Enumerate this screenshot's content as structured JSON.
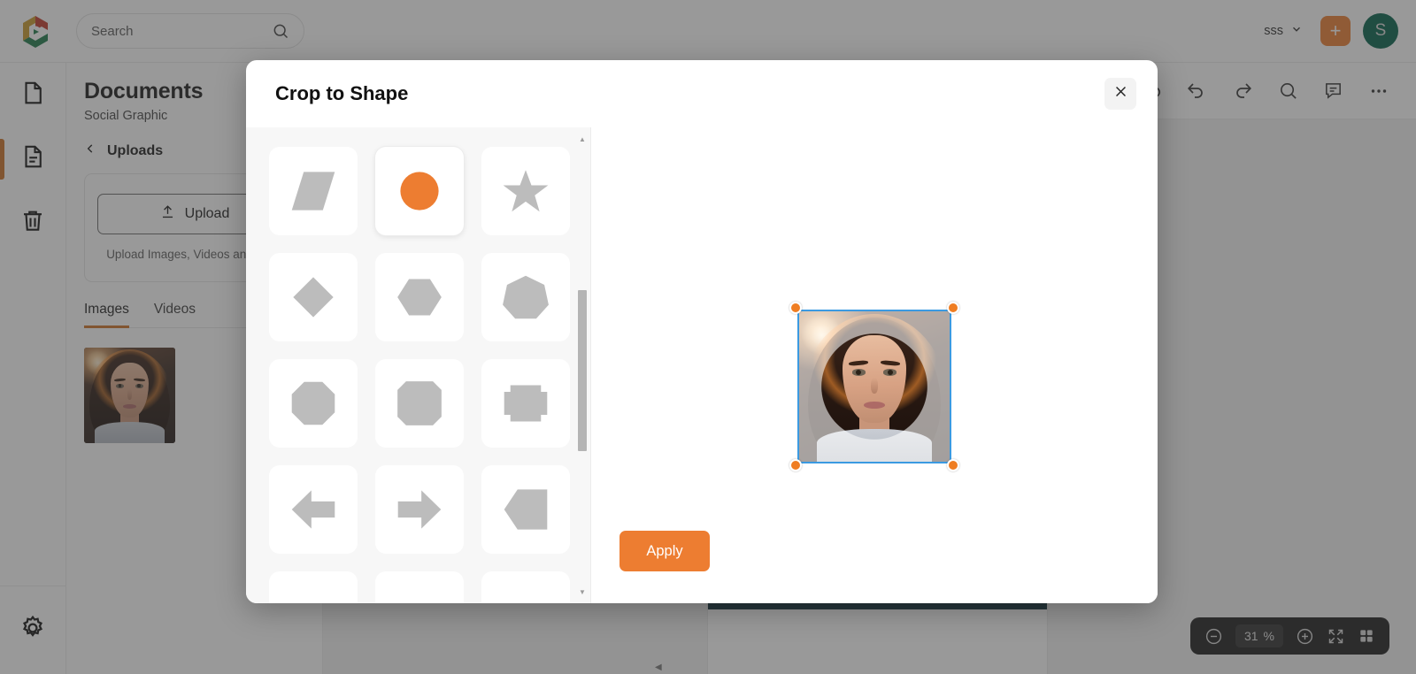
{
  "topbar": {
    "logo_icon": "app-logo-hexagon",
    "search": {
      "value": "",
      "placeholder": "Search",
      "icon": "search-icon"
    },
    "brand": {
      "label": "sss",
      "chevron_icon": "chevron-down-icon"
    },
    "create_button": {
      "label": "+",
      "icon": "plus-icon",
      "color": "#ed7d31"
    },
    "avatar": {
      "initial": "S",
      "color": "#04614a"
    }
  },
  "rail": {
    "items": [
      {
        "icon": "page-blank-icon",
        "active": false
      },
      {
        "icon": "document-lines-icon",
        "active": true
      },
      {
        "icon": "trash-icon",
        "active": false
      }
    ],
    "settings": {
      "icon": "gear-icon"
    }
  },
  "panel": {
    "title": "Documents",
    "subtitle": "Social Graphic",
    "back": {
      "label": "Uploads",
      "icon": "chevron-left-icon"
    },
    "upload": {
      "button_label": "Upload",
      "button_icon": "upload-arrow-icon",
      "hint": "Upload Images, Videos and GIFs"
    },
    "tabs": [
      {
        "label": "Images",
        "active": true
      },
      {
        "label": "Videos",
        "active": false
      }
    ],
    "thumbnails": [
      {
        "alt": "portrait-photo"
      }
    ]
  },
  "doc_toolbar": {
    "icons": [
      "cloud-saved-icon",
      "undo-icon",
      "redo-icon",
      "search-icon",
      "comment-icon",
      "more-options-icon"
    ]
  },
  "zoom_toolbar": {
    "zoom_out_icon": "minus-circle-icon",
    "zoom_value": "31",
    "zoom_unit": "%",
    "zoom_in_icon": "plus-circle-icon",
    "fullscreen_icon": "expand-arrows-icon",
    "grid_icon": "grid-view-icon"
  },
  "modal": {
    "title": "Crop to Shape",
    "close_icon": "close-icon",
    "apply_label": "Apply",
    "selected_shape": "circle",
    "accent_color": "#ed7d31",
    "shapes": [
      {
        "name": "parallelogram",
        "selected": false
      },
      {
        "name": "circle",
        "selected": true
      },
      {
        "name": "star",
        "selected": false
      },
      {
        "name": "diamond",
        "selected": false
      },
      {
        "name": "hexagon",
        "selected": false
      },
      {
        "name": "heptagon",
        "selected": false
      },
      {
        "name": "octagon",
        "selected": false
      },
      {
        "name": "rounded-octagon",
        "selected": false
      },
      {
        "name": "cross-square",
        "selected": false
      },
      {
        "name": "arrow-left",
        "selected": false
      },
      {
        "name": "arrow-right",
        "selected": false
      },
      {
        "name": "pentagon-left",
        "selected": false
      }
    ],
    "preview": {
      "image_alt": "portrait-photo",
      "crop_shape": "circle",
      "selection_border_color": "#3b9ae1",
      "handle_color": "#ef7d22",
      "handles": [
        "top-left",
        "top-right",
        "bottom-left",
        "bottom-right"
      ]
    },
    "scrollbar": {
      "up_arrow": "▲",
      "down_arrow": "▼"
    }
  }
}
